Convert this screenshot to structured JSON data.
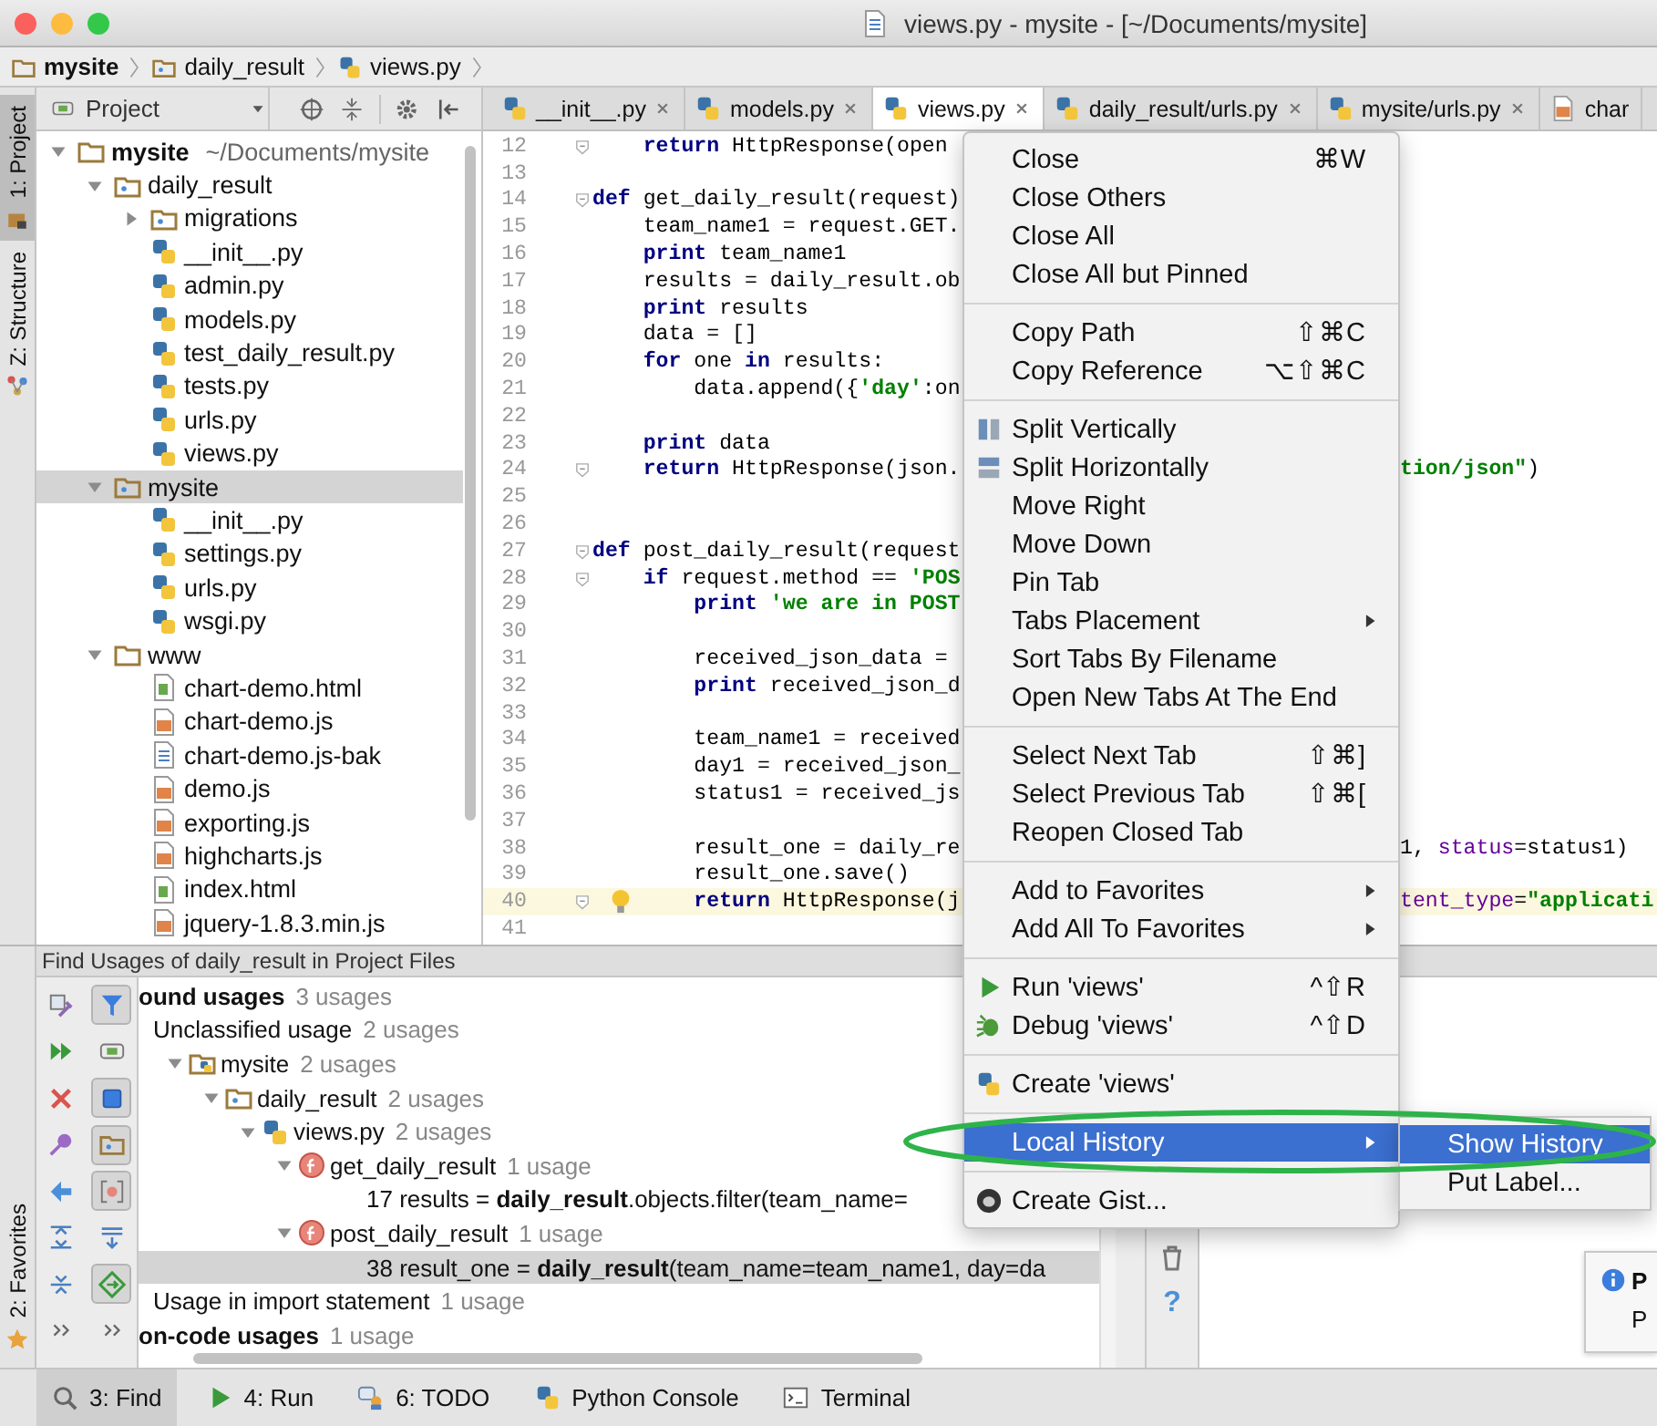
{
  "window": {
    "title": "views.py - mysite - [~/Documents/mysite]"
  },
  "breadcrumbs": [
    {
      "label": "mysite",
      "kind": "folder"
    },
    {
      "label": "daily_result",
      "kind": "package"
    },
    {
      "label": "views.py",
      "kind": "python"
    }
  ],
  "side_tabs": [
    {
      "label": "1: Project",
      "selected": true
    },
    {
      "label": "Z: Structure",
      "selected": false
    }
  ],
  "project": {
    "view": "Project",
    "tree": [
      {
        "label": "mysite",
        "path": "~/Documents/mysite",
        "kind": "folder",
        "expanded": true,
        "selected": false,
        "children": [
          {
            "label": "daily_result",
            "kind": "package",
            "expanded": true,
            "selected": false,
            "children": [
              {
                "label": "migrations",
                "kind": "package",
                "expanded": false,
                "selected": false
              },
              {
                "label": "__init__.py",
                "kind": "python",
                "selected": false
              },
              {
                "label": "admin.py",
                "kind": "python",
                "selected": false
              },
              {
                "label": "models.py",
                "kind": "python",
                "selected": false
              },
              {
                "label": "test_daily_result.py",
                "kind": "python",
                "selected": false
              },
              {
                "label": "tests.py",
                "kind": "python",
                "selected": false
              },
              {
                "label": "urls.py",
                "kind": "python",
                "selected": false
              },
              {
                "label": "views.py",
                "kind": "python",
                "selected": false
              }
            ]
          },
          {
            "label": "mysite",
            "kind": "package",
            "expanded": true,
            "selected": true,
            "children": [
              {
                "label": "__init__.py",
                "kind": "python",
                "selected": false
              },
              {
                "label": "settings.py",
                "kind": "python",
                "selected": false
              },
              {
                "label": "urls.py",
                "kind": "python",
                "selected": false
              },
              {
                "label": "wsgi.py",
                "kind": "python",
                "selected": false
              }
            ]
          },
          {
            "label": "www",
            "kind": "folder",
            "expanded": true,
            "selected": false,
            "children": [
              {
                "label": "chart-demo.html",
                "kind": "html",
                "selected": false
              },
              {
                "label": "chart-demo.js",
                "kind": "js",
                "selected": false
              },
              {
                "label": "chart-demo.js-bak",
                "kind": "text",
                "selected": false
              },
              {
                "label": "demo.js",
                "kind": "js",
                "selected": false
              },
              {
                "label": "exporting.js",
                "kind": "js",
                "selected": false
              },
              {
                "label": "highcharts.js",
                "kind": "js",
                "selected": false
              },
              {
                "label": "index.html",
                "kind": "html",
                "selected": false
              },
              {
                "label": "jquery-1.8.3.min.js",
                "kind": "js",
                "selected": false
              }
            ]
          }
        ]
      }
    ]
  },
  "editor": {
    "tabs": [
      {
        "label": "__init__.py",
        "kind": "python",
        "selected": false,
        "closable": true
      },
      {
        "label": "models.py",
        "kind": "python",
        "selected": false,
        "closable": true
      },
      {
        "label": "views.py",
        "kind": "python",
        "selected": true,
        "closable": true
      },
      {
        "label": "daily_result/urls.py",
        "kind": "python",
        "selected": false,
        "closable": true
      },
      {
        "label": "mysite/urls.py",
        "kind": "python",
        "selected": false,
        "closable": true
      },
      {
        "label": "char",
        "kind": "js",
        "selected": false,
        "closable": false
      }
    ],
    "lines": [
      {
        "number": "12",
        "fold": true,
        "current": false,
        "hint": false,
        "code": [
          {
            "kind": "keyword",
            "text": "    return"
          },
          {
            "kind": "plain",
            "text": " HttpResponse(open"
          }
        ]
      },
      {
        "number": "13",
        "fold": false,
        "current": false,
        "hint": false
      },
      {
        "number": "14",
        "fold": true,
        "current": false,
        "hint": false,
        "code": [
          {
            "kind": "keyword",
            "text": "def"
          },
          {
            "kind": "plain",
            "text": " get_daily_result(request)"
          }
        ]
      },
      {
        "number": "15",
        "fold": false,
        "current": false,
        "hint": false,
        "code": [
          {
            "kind": "plain",
            "text": "    team_name1 = request.GET."
          }
        ]
      },
      {
        "number": "16",
        "fold": false,
        "current": false,
        "hint": false,
        "code": [
          {
            "kind": "keyword",
            "text": "    print"
          },
          {
            "kind": "plain",
            "text": " team_name1"
          }
        ]
      },
      {
        "number": "17",
        "fold": false,
        "current": false,
        "hint": false,
        "code": [
          {
            "kind": "plain",
            "text": "    results = daily_result.ob"
          }
        ]
      },
      {
        "number": "18",
        "fold": false,
        "current": false,
        "hint": false,
        "code": [
          {
            "kind": "keyword",
            "text": "    print"
          },
          {
            "kind": "plain",
            "text": " results"
          }
        ]
      },
      {
        "number": "19",
        "fold": false,
        "current": false,
        "hint": false,
        "code": [
          {
            "kind": "plain",
            "text": "    data = []"
          }
        ]
      },
      {
        "number": "20",
        "fold": false,
        "current": false,
        "hint": false,
        "code": [
          {
            "kind": "keyword",
            "text": "    for"
          },
          {
            "kind": "plain",
            "text": " one "
          },
          {
            "kind": "keyword",
            "text": "in"
          },
          {
            "kind": "plain",
            "text": " results:"
          }
        ]
      },
      {
        "number": "21",
        "fold": false,
        "current": false,
        "hint": false,
        "code": [
          {
            "kind": "plain",
            "text": "        data.append({"
          },
          {
            "kind": "string",
            "text": "'day'"
          },
          {
            "kind": "plain",
            "text": ":on"
          }
        ]
      },
      {
        "number": "22",
        "fold": false,
        "current": false,
        "hint": false
      },
      {
        "number": "23",
        "fold": false,
        "current": false,
        "hint": false,
        "code": [
          {
            "kind": "keyword",
            "text": "    print"
          },
          {
            "kind": "plain",
            "text": " data"
          }
        ]
      },
      {
        "number": "24",
        "fold": true,
        "current": false,
        "hint": false,
        "code": [
          {
            "kind": "keyword",
            "text": "    return"
          },
          {
            "kind": "plain",
            "text": " HttpResponse(json."
          }
        ],
        "code_right": [
          {
            "kind": "string",
            "text": "tion/json\""
          },
          {
            "kind": "plain",
            "text": ")"
          }
        ]
      },
      {
        "number": "25",
        "fold": false,
        "current": false,
        "hint": false
      },
      {
        "number": "26",
        "fold": false,
        "current": false,
        "hint": false
      },
      {
        "number": "27",
        "fold": true,
        "current": false,
        "hint": false,
        "code": [
          {
            "kind": "keyword",
            "text": "def"
          },
          {
            "kind": "plain",
            "text": " post_daily_result(request"
          }
        ]
      },
      {
        "number": "28",
        "fold": true,
        "current": false,
        "hint": false,
        "code": [
          {
            "kind": "keyword",
            "text": "    if"
          },
          {
            "kind": "plain",
            "text": " request.method == "
          },
          {
            "kind": "string",
            "text": "'POS"
          }
        ]
      },
      {
        "number": "29",
        "fold": false,
        "current": false,
        "hint": false,
        "code": [
          {
            "kind": "keyword",
            "text": "        print "
          },
          {
            "kind": "string",
            "text": "'we are in POST"
          }
        ]
      },
      {
        "number": "30",
        "fold": false,
        "current": false,
        "hint": false
      },
      {
        "number": "31",
        "fold": false,
        "current": false,
        "hint": false,
        "code": [
          {
            "kind": "plain",
            "text": "        received_json_data ="
          }
        ]
      },
      {
        "number": "32",
        "fold": false,
        "current": false,
        "hint": false,
        "code": [
          {
            "kind": "keyword",
            "text": "        print"
          },
          {
            "kind": "plain",
            "text": " received_json_d"
          }
        ]
      },
      {
        "number": "33",
        "fold": false,
        "current": false,
        "hint": false
      },
      {
        "number": "34",
        "fold": false,
        "current": false,
        "hint": false,
        "code": [
          {
            "kind": "plain",
            "text": "        team_name1 = received"
          }
        ]
      },
      {
        "number": "35",
        "fold": false,
        "current": false,
        "hint": false,
        "code": [
          {
            "kind": "plain",
            "text": "        day1 = received_json_"
          }
        ]
      },
      {
        "number": "36",
        "fold": false,
        "current": false,
        "hint": false,
        "code": [
          {
            "kind": "plain",
            "text": "        status1 = received_js"
          }
        ]
      },
      {
        "number": "37",
        "fold": false,
        "current": false,
        "hint": false
      },
      {
        "number": "38",
        "fold": false,
        "current": false,
        "hint": false,
        "code": [
          {
            "kind": "plain",
            "text": "        result_one = daily_re"
          }
        ],
        "code_right": [
          {
            "kind": "plain",
            "text": "1, "
          },
          {
            "kind": "param",
            "text": "status"
          },
          {
            "kind": "plain",
            "text": "=status1)"
          }
        ]
      },
      {
        "number": "39",
        "fold": false,
        "current": false,
        "hint": false,
        "code": [
          {
            "kind": "plain",
            "text": "        result_one.save()"
          }
        ]
      },
      {
        "number": "40",
        "fold": true,
        "current": true,
        "hint": true,
        "code": [
          {
            "kind": "keyword",
            "text": "        return"
          },
          {
            "kind": "plain",
            "text": " HttpResponse(j"
          }
        ],
        "code_right": [
          {
            "kind": "param",
            "text": "tent_type"
          },
          {
            "kind": "plain",
            "text": "="
          },
          {
            "kind": "string",
            "text": "\"applicati"
          }
        ]
      },
      {
        "number": "41",
        "fold": false,
        "current": false,
        "hint": false
      }
    ]
  },
  "context_menu": {
    "items": [
      {
        "kind": "item",
        "label": "Close",
        "shortcut": "⌘W",
        "submenu": false,
        "selected": false
      },
      {
        "kind": "item",
        "label": "Close Others",
        "submenu": false,
        "selected": false
      },
      {
        "kind": "item",
        "label": "Close All",
        "submenu": false,
        "selected": false
      },
      {
        "kind": "item",
        "label": "Close All but Pinned",
        "submenu": false,
        "selected": false
      },
      {
        "kind": "separator"
      },
      {
        "kind": "item",
        "label": "Copy Path",
        "shortcut": "⇧⌘C",
        "submenu": false,
        "selected": false
      },
      {
        "kind": "item",
        "label": "Copy Reference",
        "shortcut": "⌥⇧⌘C",
        "submenu": false,
        "selected": false
      },
      {
        "kind": "separator"
      },
      {
        "kind": "item",
        "label": "Split Vertically",
        "submenu": false,
        "selected": false
      },
      {
        "kind": "item",
        "label": "Split Horizontally",
        "submenu": false,
        "selected": false
      },
      {
        "kind": "item",
        "label": "Move Right",
        "submenu": false,
        "selected": false
      },
      {
        "kind": "item",
        "label": "Move Down",
        "submenu": false,
        "selected": false
      },
      {
        "kind": "item",
        "label": "Pin Tab",
        "submenu": false,
        "selected": false
      },
      {
        "kind": "item",
        "label": "Tabs Placement",
        "submenu": true,
        "selected": false
      },
      {
        "kind": "item",
        "label": "Sort Tabs By Filename",
        "submenu": false,
        "selected": false
      },
      {
        "kind": "item",
        "label": "Open New Tabs At The End",
        "submenu": false,
        "selected": false
      },
      {
        "kind": "separator"
      },
      {
        "kind": "item",
        "label": "Select Next Tab",
        "shortcut": "⇧⌘]",
        "submenu": false,
        "selected": false
      },
      {
        "kind": "item",
        "label": "Select Previous Tab",
        "shortcut": "⇧⌘[",
        "submenu": false,
        "selected": false
      },
      {
        "kind": "item",
        "label": "Reopen Closed Tab",
        "submenu": false,
        "selected": false
      },
      {
        "kind": "separator"
      },
      {
        "kind": "item",
        "label": "Add to Favorites",
        "submenu": true,
        "selected": false
      },
      {
        "kind": "item",
        "label": "Add All To Favorites",
        "submenu": true,
        "selected": false
      },
      {
        "kind": "separator"
      },
      {
        "kind": "item",
        "label": "Run 'views'",
        "shortcut": "^⇧R",
        "submenu": false,
        "selected": false
      },
      {
        "kind": "item",
        "label": "Debug 'views'",
        "shortcut": "^⇧D",
        "submenu": false,
        "selected": false
      },
      {
        "kind": "separator"
      },
      {
        "kind": "item",
        "label": "Create 'views'",
        "submenu": false,
        "selected": false
      },
      {
        "kind": "separator"
      },
      {
        "kind": "item",
        "label": "Local History",
        "submenu": true,
        "selected": true,
        "children": [
          {
            "label": "Show History",
            "selected": true
          },
          {
            "label": "Put Label...",
            "selected": false
          }
        ]
      },
      {
        "kind": "separator"
      },
      {
        "kind": "item",
        "label": "Create Gist...",
        "submenu": false,
        "selected": false
      }
    ]
  },
  "find": {
    "title": "Find Usages of daily_result in Project Files",
    "tools": [
      {
        "selected": false
      },
      {
        "selected": false
      },
      {
        "selected": false
      },
      {
        "selected": false
      },
      {
        "selected": false
      },
      {
        "selected": false
      },
      {
        "selected": false
      },
      {
        "selected": false
      },
      {
        "selected": true
      },
      {
        "selected": false
      },
      {
        "selected": true
      },
      {
        "selected": true
      },
      {
        "selected": true
      },
      {
        "selected": false
      },
      {
        "selected": true
      },
      {
        "selected": false
      }
    ],
    "results": [
      {
        "label": "ound usages",
        "count": "3 usages",
        "kind": "root",
        "selected": false,
        "children": [
          {
            "label": "Unclassified usage",
            "count": "2 usages",
            "kind": "category",
            "selected": false,
            "children": [
              {
                "label": "mysite",
                "count": "2 usages",
                "kind": "module",
                "expanded": true,
                "selected": false,
                "children": [
                  {
                    "label": "daily_result",
                    "count": "2 usages",
                    "kind": "package",
                    "expanded": true,
                    "selected": false,
                    "children": [
                      {
                        "label": "views.py",
                        "count": "2 usages",
                        "kind": "file",
                        "expanded": true,
                        "selected": false,
                        "children": [
                          {
                            "label": "get_daily_result",
                            "count": "1 usage",
                            "kind": "function",
                            "expanded": true,
                            "selected": false,
                            "children": [
                              {
                                "label": "17 results = **daily_result**.objects.filter(team_name=",
                                "kind": "line",
                                "selected": false
                              }
                            ]
                          },
                          {
                            "label": "post_daily_result",
                            "count": "1 usage",
                            "kind": "function",
                            "expanded": true,
                            "selected": false,
                            "children": [
                              {
                                "label": "38 result_one = **daily_result**(team_name=team_name1, day=da",
                                "kind": "line",
                                "selected": true
                              }
                            ]
                          }
                        ]
                      }
                    ]
                  }
                ]
              }
            ]
          },
          {
            "label": "Usage in import statement",
            "count": "1 usage",
            "kind": "category",
            "selected": false
          }
        ]
      },
      {
        "label": "on-code usages",
        "count": "1 usage",
        "kind": "root",
        "selected": false
      }
    ]
  },
  "side_actions": {
    "help": "?"
  },
  "notification": {
    "title": "P",
    "body": "P"
  },
  "bottom_side_tabs": [
    {
      "label": "2: Favorites",
      "selected": false
    }
  ],
  "tool_windows": [
    {
      "label": "3: Find",
      "selected": true
    },
    {
      "label": "4: Run",
      "selected": false
    },
    {
      "label": "6: TODO",
      "selected": false
    },
    {
      "label": "Python Console",
      "selected": false
    },
    {
      "label": "Terminal",
      "selected": false
    }
  ]
}
